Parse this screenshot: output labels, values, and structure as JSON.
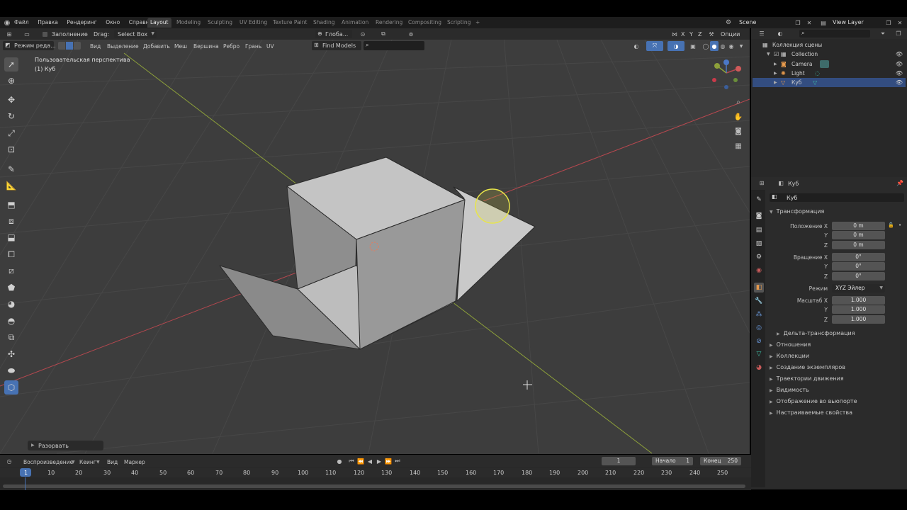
{
  "topbar": {
    "menus": [
      "Файл",
      "Правка",
      "Рендеринг",
      "Окно",
      "Справка"
    ],
    "workspace_tabs": [
      "Layout",
      "Modeling",
      "Sculpting",
      "UV Editing",
      "Texture Paint",
      "Shading",
      "Animation",
      "Rendering",
      "Compositing",
      "Scripting"
    ],
    "add_tab": "+",
    "scene": "Scene",
    "view_layer": "View Layer"
  },
  "tool_header": {
    "fill_label": "Заполнение",
    "drag_label": "Drag:",
    "drag_value": "Select Box",
    "orientation": "Глоба...",
    "axes": [
      "X",
      "Y",
      "Z"
    ],
    "options": "Опции"
  },
  "viewport_header": {
    "mode": "Режим реда...",
    "menus": [
      "Вид",
      "Выделение",
      "Добавить",
      "Меш",
      "Вершина",
      "Ребро",
      "Грань",
      "UV"
    ],
    "find_models": "Find Models"
  },
  "viewport": {
    "perspective": "Пользовательская перспектива",
    "object": "(1) Куб",
    "operator_panel": "Разорвать"
  },
  "outliner": {
    "root": "Коллекция сцены",
    "collection": "Collection",
    "items": [
      "Camera",
      "Light",
      "Куб"
    ]
  },
  "properties": {
    "object_name_header": "Куб",
    "object_name": "Куб",
    "transform_title": "Трансформация",
    "location_label_x": "Положение X",
    "rotation_label_x": "Вращение X",
    "scale_label_x": "Масштаб X",
    "y": "Y",
    "z": "Z",
    "location": [
      "0 m",
      "0 m",
      "0 m"
    ],
    "rotation": [
      "0°",
      "0°",
      "0°"
    ],
    "mode_label": "Режим",
    "mode_value": "XYZ Эйлер",
    "scale": [
      "1.000",
      "1.000",
      "1.000"
    ],
    "delta": "Дельта-трансформация",
    "sections": [
      "Отношения",
      "Коллекции",
      "Создание экземпляров",
      "Траектории движения",
      "Видимость",
      "Отображение во вьюпорте",
      "Настраиваемые свойства"
    ]
  },
  "timeline": {
    "menus": [
      "Воспроизведение",
      "Кеинг",
      "Вид",
      "Маркер"
    ],
    "current_frame": "1",
    "start_label": "Начало",
    "start_value": "1",
    "end_label": "Конец",
    "end_value": "250",
    "ticks": [
      "1",
      "10",
      "20",
      "30",
      "40",
      "50",
      "60",
      "70",
      "80",
      "90",
      "100",
      "110",
      "120",
      "130",
      "140",
      "150",
      "160",
      "170",
      "180",
      "190",
      "200",
      "210",
      "220",
      "230",
      "240",
      "250"
    ]
  },
  "colors": {
    "accent": "#4772b3",
    "x_axis": "#b6484f",
    "y_axis": "#8da03a",
    "viewport_bg": "#3d3d3d",
    "selection": "#e8e54a"
  }
}
